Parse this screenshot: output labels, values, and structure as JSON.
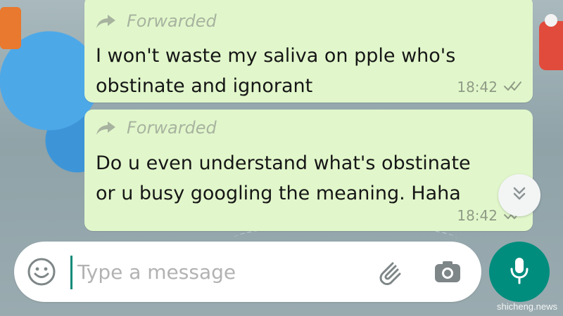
{
  "messages": [
    {
      "forwarded_label": "Forwarded",
      "text_lines": [
        "I won't waste my saliva on pple who's",
        "obstinate and ignorant"
      ],
      "time": "18:42",
      "tick_icon": "double-check-icon"
    },
    {
      "forwarded_label": "Forwarded",
      "text_lines": [
        "Do u even understand what's obstinate",
        "or u busy googling the meaning. Haha"
      ],
      "time": "18:42",
      "tick_icon": "double-check-icon"
    }
  ],
  "composer": {
    "placeholder": "Type a message",
    "emoji_icon": "emoji-icon",
    "attach_icon": "paperclip-icon",
    "camera_icon": "camera-icon",
    "mic_icon": "microphone-icon"
  },
  "scroll_button": {
    "icon": "chevrons-down-icon"
  },
  "watermark": "shicheng.news",
  "colors": {
    "bubble": "#e1f7cb",
    "accent": "#008d7e",
    "meta": "#8f9b86",
    "forwarded": "#a7b39f"
  }
}
